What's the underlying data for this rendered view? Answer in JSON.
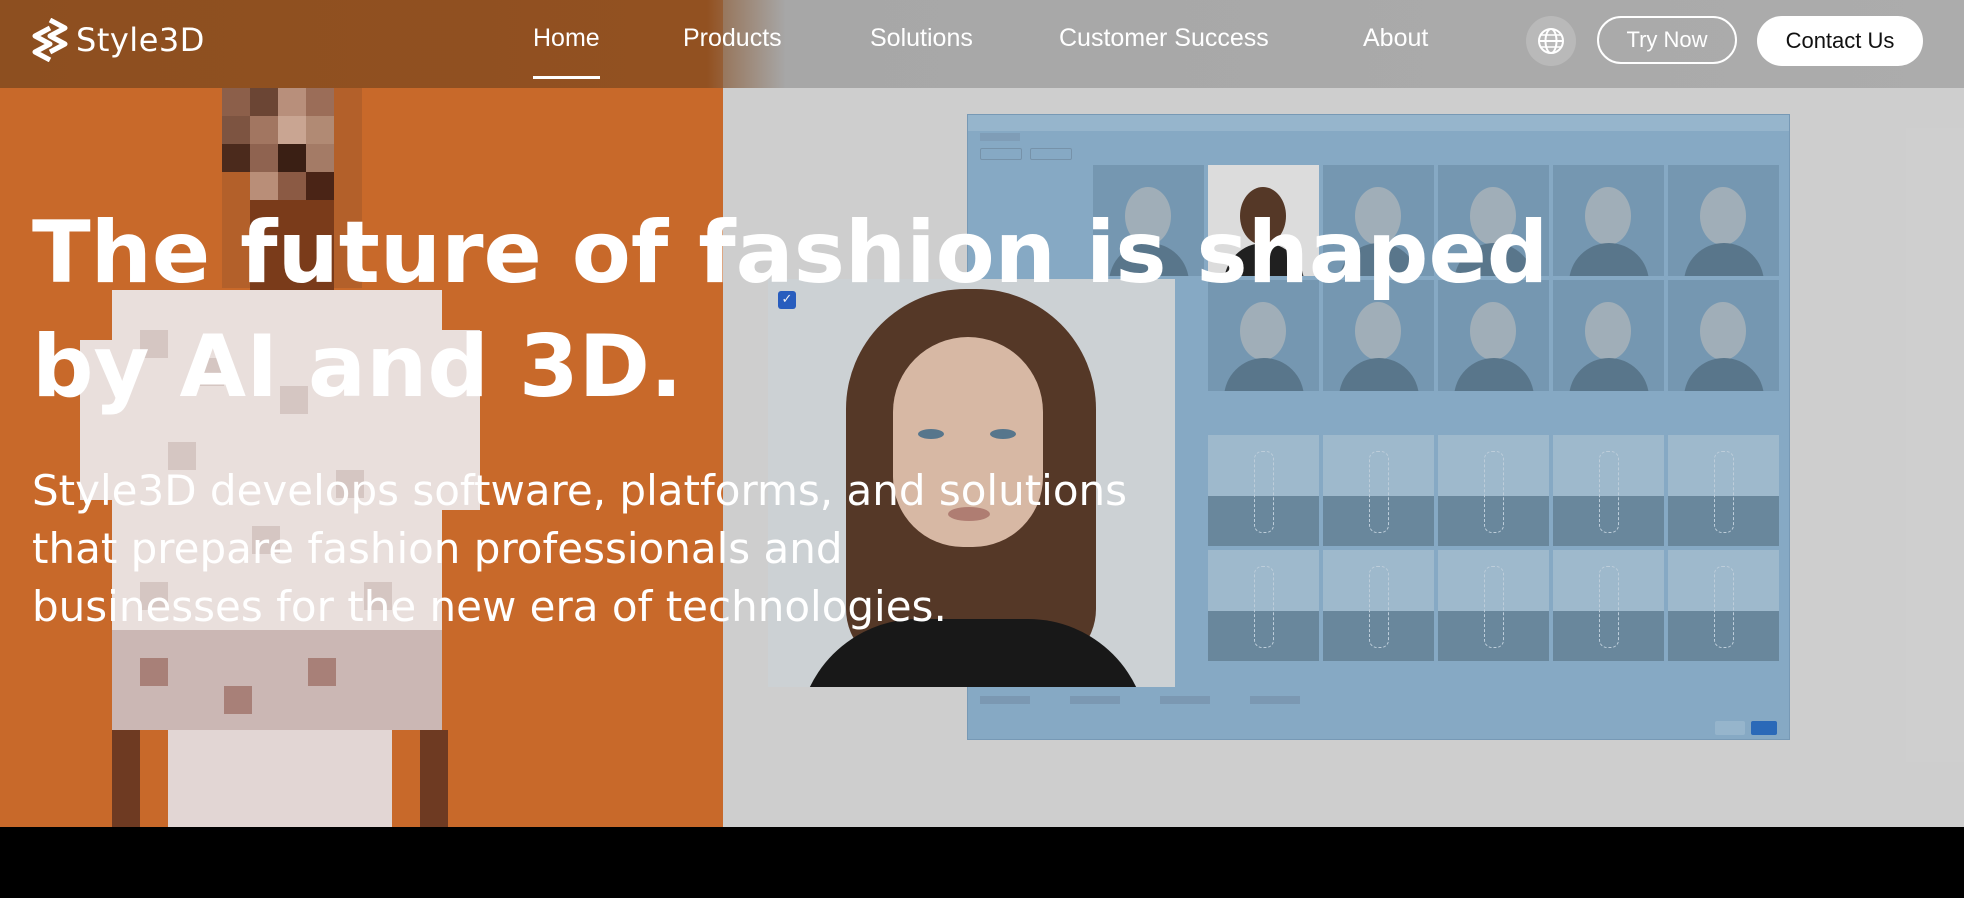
{
  "nav": {
    "logo_text": "Style3D",
    "links": [
      {
        "label": "Home"
      },
      {
        "label": "Products"
      },
      {
        "label": "Solutions"
      },
      {
        "label": "Customer Success"
      },
      {
        "label": "About"
      }
    ],
    "active": "Home",
    "language_icon": "globe-icon",
    "try_now_label": "Try Now",
    "contact_label": "Contact Us"
  },
  "hero": {
    "headline_line1": "The future of fashion is shaped",
    "headline_line2": "by AI and 3D.",
    "subtext_line1": "Style3D develops software, platforms, and solutions",
    "subtext_line2": "that prepare fashion professionals and",
    "subtext_line3": "businesses for the new era of technologies."
  },
  "colors": {
    "left_panel": "#c8692a",
    "right_panel": "#dadada",
    "app_accent": "#2b62c9",
    "text": "#ffffff"
  }
}
